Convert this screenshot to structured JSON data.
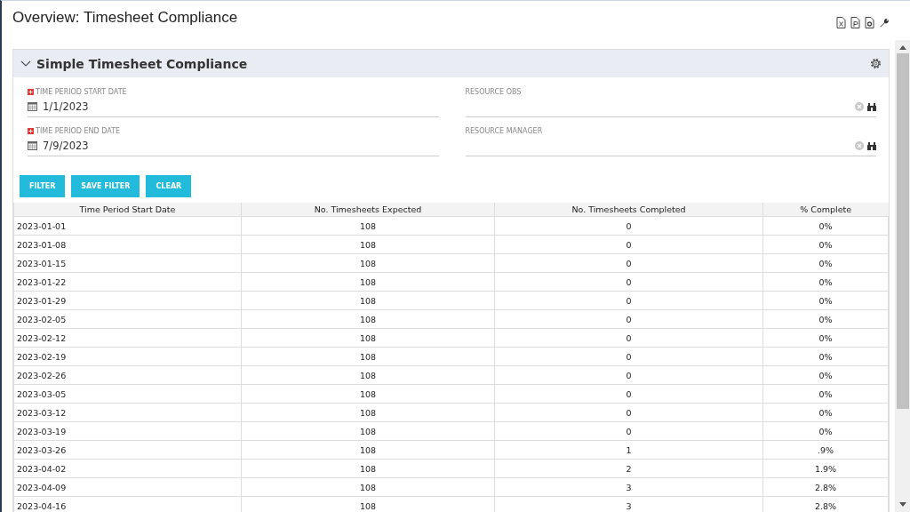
{
  "page": {
    "title": "Overview: Timesheet Compliance"
  },
  "toolbar": [
    {
      "kind": "excel"
    },
    {
      "kind": "pdf"
    },
    {
      "kind": "export"
    },
    {
      "kind": "wrench"
    }
  ],
  "panel": {
    "title": "Simple Timesheet Compliance",
    "expanded": true
  },
  "filters": [
    {
      "label": "TIME PERIOD START DATE",
      "required": true,
      "kind": "date",
      "value": "1/1/2023"
    },
    {
      "label": "RESOURCE OBS",
      "required": false,
      "kind": "lookup"
    },
    {
      "label": "TIME PERIOD END DATE",
      "required": true,
      "kind": "date",
      "value": "7/9/2023"
    },
    {
      "label": "RESOURCE MANAGER",
      "required": false,
      "kind": "lookup"
    }
  ],
  "buttons": [
    "FILTER",
    "SAVE FILTER",
    "CLEAR"
  ],
  "table": {
    "columns": [
      "Time Period Start Date",
      "No. Timesheets Expected",
      "No. Timesheets Completed",
      "% Complete"
    ],
    "rows": [
      [
        "2023-01-01",
        "108",
        "0",
        "0%"
      ],
      [
        "2023-01-08",
        "108",
        "0",
        "0%"
      ],
      [
        "2023-01-15",
        "108",
        "0",
        "0%"
      ],
      [
        "2023-01-22",
        "108",
        "0",
        "0%"
      ],
      [
        "2023-01-29",
        "108",
        "0",
        "0%"
      ],
      [
        "2023-02-05",
        "108",
        "0",
        "0%"
      ],
      [
        "2023-02-12",
        "108",
        "0",
        "0%"
      ],
      [
        "2023-02-19",
        "108",
        "0",
        "0%"
      ],
      [
        "2023-02-26",
        "108",
        "0",
        "0%"
      ],
      [
        "2023-03-05",
        "108",
        "0",
        "0%"
      ],
      [
        "2023-03-12",
        "108",
        "0",
        "0%"
      ],
      [
        "2023-03-19",
        "108",
        "0",
        "0%"
      ],
      [
        "2023-03-26",
        "108",
        "1",
        ".9%"
      ],
      [
        "2023-04-02",
        "108",
        "2",
        "1.9%"
      ],
      [
        "2023-04-09",
        "108",
        "3",
        "2.8%"
      ],
      [
        "2023-04-16",
        "108",
        "3",
        "2.8%"
      ]
    ]
  }
}
